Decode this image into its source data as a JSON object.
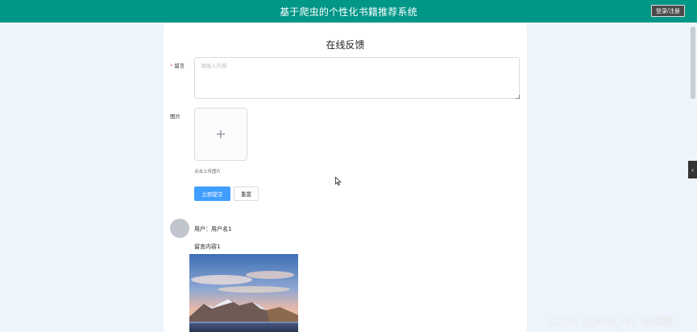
{
  "header": {
    "title": "基于爬虫的个性化书籍推荐系统",
    "login_label": "登录/注册"
  },
  "form": {
    "title": "在线反馈",
    "message_label": "留言",
    "message_placeholder": "请输入内容",
    "image_label": "图片",
    "upload_plus": "+",
    "upload_tip": "点击上传图片",
    "submit_label": "立即提交",
    "reset_label": "重置"
  },
  "comment": {
    "user_line": "用户：用户名1",
    "content": "留言内容1"
  },
  "side_handle": {
    "arrow": "‹"
  },
  "watermark": "CSDN @Java_IoT 攻城狮",
  "colors": {
    "header_bg": "#009688",
    "primary": "#409eff",
    "page_bg": "#eef4fb",
    "required_star": "#f56c6c"
  },
  "icons": {
    "upload": "plus-icon",
    "collapse": "chevron-left-icon",
    "pointer": "mouse-cursor-icon"
  }
}
